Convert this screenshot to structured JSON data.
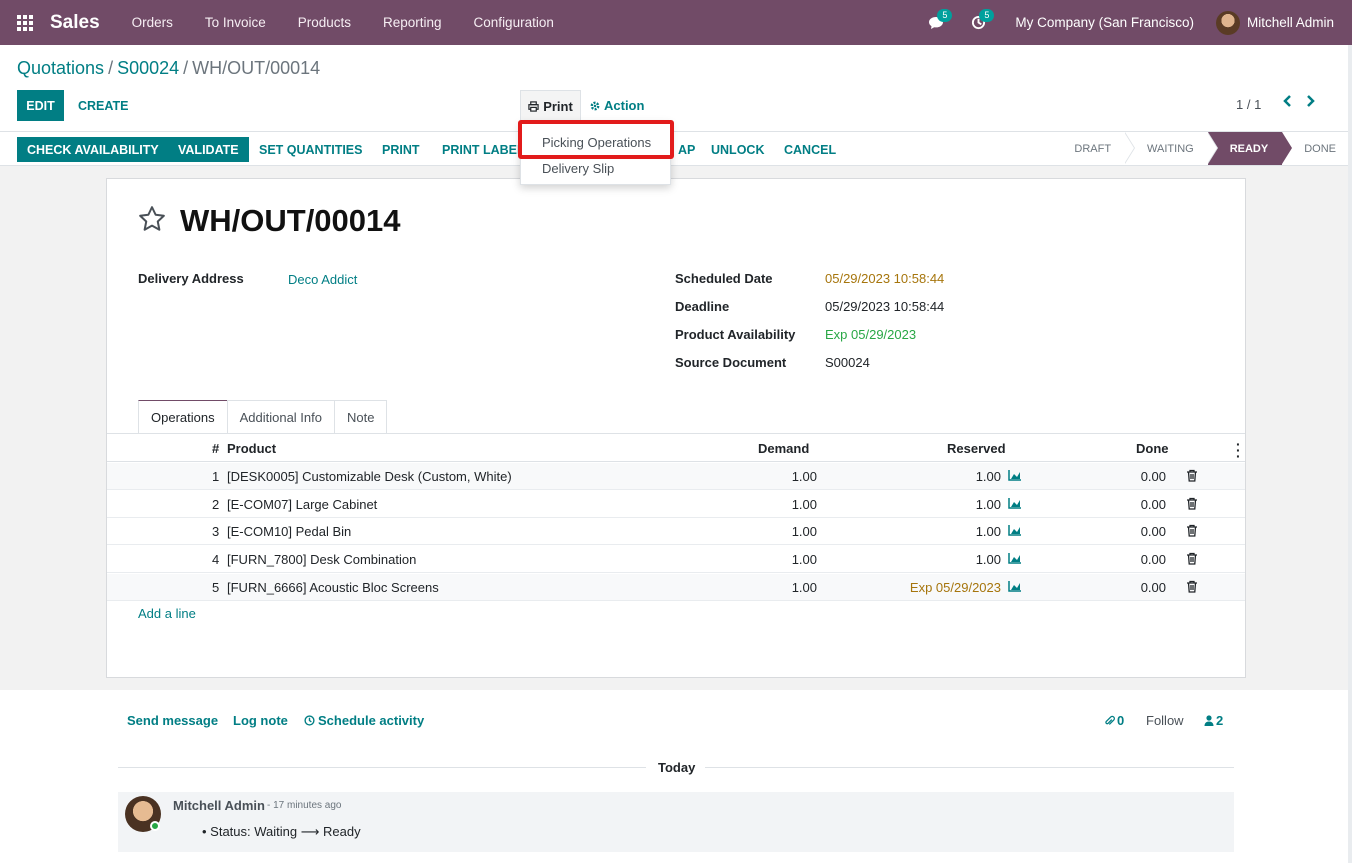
{
  "navbar": {
    "app_name": "Sales",
    "menu": [
      "Orders",
      "To Invoice",
      "Products",
      "Reporting",
      "Configuration"
    ],
    "messages_count": "5",
    "activities_count": "5",
    "company": "My Company (San Francisco)",
    "user": "Mitchell Admin"
  },
  "breadcrumb": {
    "first": "Quotations",
    "second": "S00024",
    "current": "WH/OUT/00014"
  },
  "control": {
    "edit": "EDIT",
    "create": "CREATE",
    "print": "Print",
    "action": "Action",
    "pager": "1 / 1"
  },
  "print_menu": {
    "items": [
      "Picking Operations",
      "Delivery Slip"
    ]
  },
  "statusbar": {
    "buttons": [
      "CHECK AVAILABILITY",
      "VALIDATE",
      "SET QUANTITIES",
      "PRINT",
      "PRINT LABEL",
      "AP",
      "UNLOCK",
      "CANCEL"
    ],
    "stages": [
      "DRAFT",
      "WAITING",
      "READY",
      "DONE"
    ],
    "active_stage": "READY"
  },
  "record": {
    "name": "WH/OUT/00014",
    "delivery_address_label": "Delivery Address",
    "delivery_address": "Deco Addict",
    "scheduled_date_label": "Scheduled Date",
    "scheduled_date": "05/29/2023 10:58:44",
    "deadline_label": "Deadline",
    "deadline": "05/29/2023 10:58:44",
    "availability_label": "Product Availability",
    "availability": "Exp 05/29/2023",
    "source_label": "Source Document",
    "source": "S00024"
  },
  "tabs": [
    "Operations",
    "Additional Info",
    "Note"
  ],
  "table": {
    "headers": {
      "num": "#",
      "product": "Product",
      "demand": "Demand",
      "reserved": "Reserved",
      "done": "Done"
    },
    "rows": [
      {
        "num": "1",
        "product": "[DESK0005] Customizable Desk (Custom, White)",
        "demand": "1.00",
        "reserved": "1.00",
        "done": "0.00"
      },
      {
        "num": "2",
        "product": "[E-COM07] Large Cabinet",
        "demand": "1.00",
        "reserved": "1.00",
        "done": "0.00"
      },
      {
        "num": "3",
        "product": "[E-COM10] Pedal Bin",
        "demand": "1.00",
        "reserved": "1.00",
        "done": "0.00"
      },
      {
        "num": "4",
        "product": "[FURN_7800] Desk Combination",
        "demand": "1.00",
        "reserved": "1.00",
        "done": "0.00"
      },
      {
        "num": "5",
        "product": "[FURN_6666] Acoustic Bloc Screens",
        "demand": "1.00",
        "reserved": "Exp 05/29/2023",
        "done": "0.00"
      }
    ],
    "add_line": "Add a line"
  },
  "chatter": {
    "send_message": "Send message",
    "log_note": "Log note",
    "schedule_activity": "Schedule activity",
    "attachments": "0",
    "follow": "Follow",
    "followers": "2",
    "today": "Today",
    "message": {
      "author": "Mitchell Admin",
      "time": "- 17 minutes ago",
      "status_label": "Status: Waiting",
      "status_new": "Ready"
    }
  },
  "colors": {
    "brand": "#714b67",
    "primary": "#017e84",
    "warning": "#a6750c",
    "success": "#28a745"
  }
}
